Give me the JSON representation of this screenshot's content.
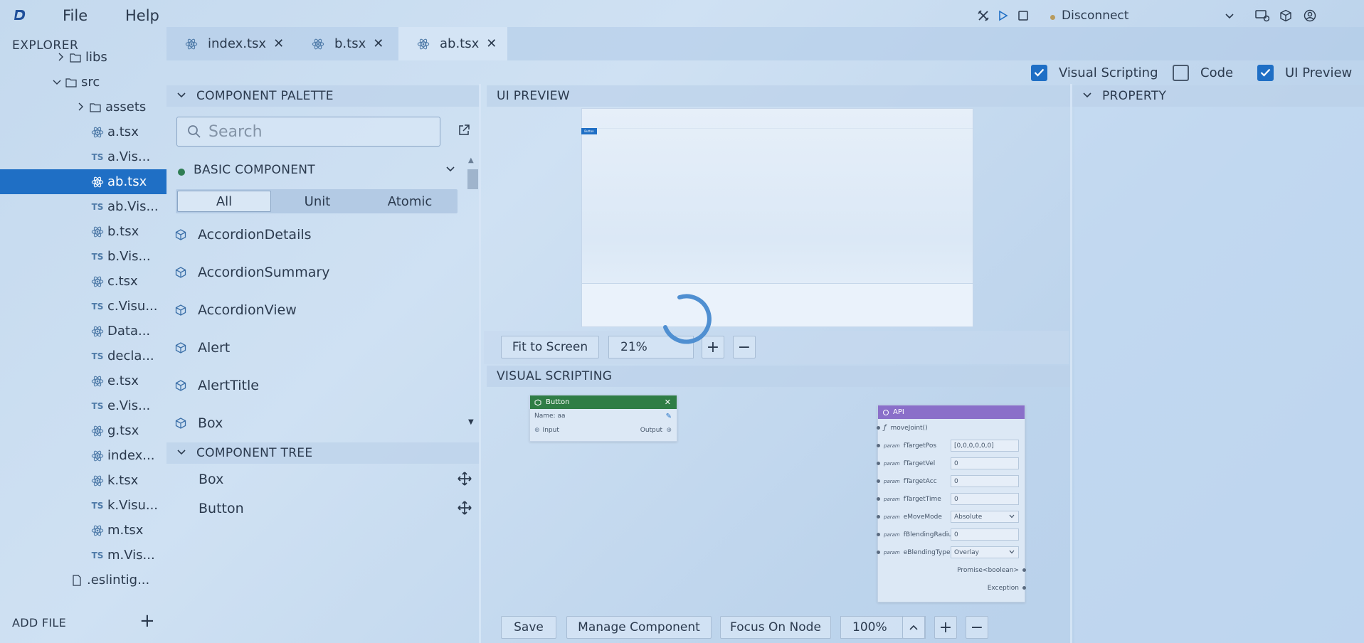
{
  "menu": {
    "file": "File",
    "help": "Help"
  },
  "connection": {
    "label": "Disconnect",
    "status_color": "#b89b5e"
  },
  "explorer": {
    "title": "EXPLORER",
    "items": [
      {
        "label": "libs",
        "type": "folder",
        "chevron": "right"
      },
      {
        "label": "src",
        "type": "folder",
        "chevron": "down"
      },
      {
        "label": "assets",
        "type": "folder",
        "chevron": "right"
      },
      {
        "label": "a.tsx",
        "type": "react"
      },
      {
        "label": "a.Vis...",
        "type": "ts"
      },
      {
        "label": "ab.tsx",
        "type": "react",
        "selected": true
      },
      {
        "label": "ab.Vis...",
        "type": "ts"
      },
      {
        "label": "b.tsx",
        "type": "react"
      },
      {
        "label": "b.Vis...",
        "type": "ts"
      },
      {
        "label": "c.tsx",
        "type": "react"
      },
      {
        "label": "c.Visu...",
        "type": "ts"
      },
      {
        "label": "Data...",
        "type": "react"
      },
      {
        "label": "decla...",
        "type": "ts"
      },
      {
        "label": "e.tsx",
        "type": "react"
      },
      {
        "label": "e.Vis...",
        "type": "ts"
      },
      {
        "label": "g.tsx",
        "type": "react"
      },
      {
        "label": "index...",
        "type": "react"
      },
      {
        "label": "k.tsx",
        "type": "react"
      },
      {
        "label": "k.Visu...",
        "type": "ts"
      },
      {
        "label": "m.tsx",
        "type": "react"
      },
      {
        "label": "m.Vis...",
        "type": "ts"
      },
      {
        "label": ".eslintig...",
        "type": "file"
      }
    ],
    "ts_badge": "TS",
    "add_file": "ADD FILE"
  },
  "tabs": [
    {
      "label": "index.tsx"
    },
    {
      "label": "b.tsx"
    },
    {
      "label": "ab.tsx",
      "active": true
    }
  ],
  "view_toggles": {
    "visual_scripting": "Visual Scripting",
    "code": "Code",
    "ui_preview": "UI Preview"
  },
  "palette": {
    "title": "COMPONENT PALETTE",
    "search_placeholder": "Search",
    "basic_label": "BASIC COMPONENT",
    "segments": [
      "All",
      "Unit",
      "Atomic"
    ],
    "items": [
      "AccordionDetails",
      "AccordionSummary",
      "AccordionView",
      "Alert",
      "AlertTitle",
      "Box"
    ]
  },
  "component_tree": {
    "title": "COMPONENT TREE",
    "items": [
      "Box",
      "Button"
    ]
  },
  "ui_preview": {
    "title": "UI PREVIEW",
    "mini_button": "Button",
    "fit_label": "Fit to Screen",
    "zoom": "21%"
  },
  "visual_scripting": {
    "title": "VISUAL SCRIPTING",
    "button_node": {
      "title": "Button",
      "name_line": "Name: aa",
      "input": "Input",
      "output": "Output",
      "header_color": "#2f7d45"
    },
    "api_node": {
      "title": "API",
      "header_color": "#8a6fc9",
      "func": "moveJoint()",
      "param_tag": "param",
      "params": [
        {
          "name": "fTargetPos",
          "value": "[0,0,0,0,0,0]"
        },
        {
          "name": "fTargetVel",
          "value": "0"
        },
        {
          "name": "fTargetAcc",
          "value": "0"
        },
        {
          "name": "fTargetTime",
          "value": "0"
        },
        {
          "name": "eMoveMode",
          "value": "Absolute",
          "select": true
        },
        {
          "name": "fBlendingRadius",
          "value": "0"
        },
        {
          "name": "eBlendingType",
          "value": "Overlay",
          "select": true
        }
      ],
      "return": "Promise<boolean>",
      "exception": "Exception"
    },
    "save": "Save",
    "manage": "Manage Component",
    "focus": "Focus On Node",
    "zoom": "100%"
  },
  "property": {
    "title": "PROPERTY"
  },
  "colors": {
    "accent": "#1f6fc5",
    "selection": "#1f6fc5"
  }
}
